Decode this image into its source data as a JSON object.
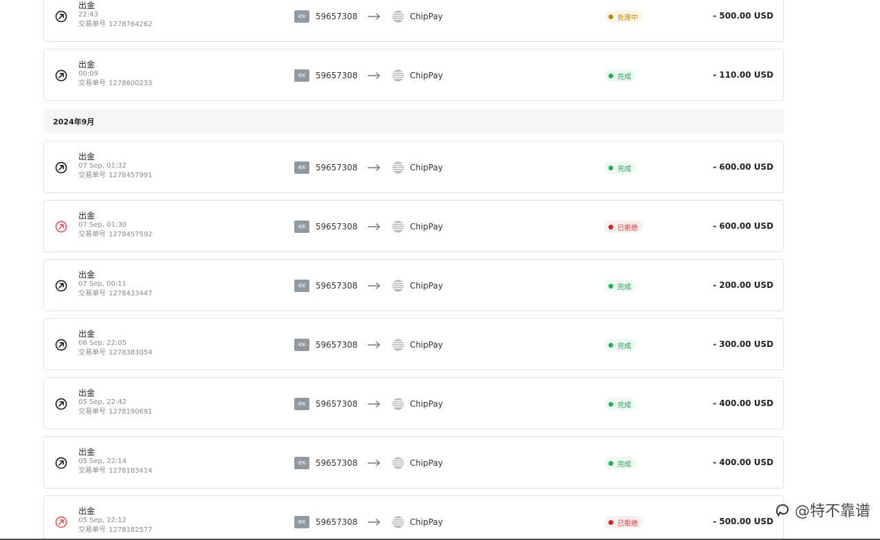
{
  "transactions_top": [
    {
      "type": "出金",
      "time": "22:43",
      "ref_label": "交易单号",
      "ref": "1278764262",
      "account": "59657308",
      "dest": "ChipPay",
      "status": "处理中",
      "status_kind": "processing",
      "amount": "- 500.00 USD",
      "icon_state": "normal"
    },
    {
      "type": "出金",
      "time": "00:09",
      "ref_label": "交易单号",
      "ref": "1278600233",
      "account": "59657308",
      "dest": "ChipPay",
      "status": "完成",
      "status_kind": "done",
      "amount": "- 110.00 USD",
      "icon_state": "normal"
    }
  ],
  "group": {
    "label": "2024年9月"
  },
  "transactions": [
    {
      "type": "出金",
      "time": "07 Sep, 01:32",
      "ref_label": "交易单号",
      "ref": "1278457991",
      "account": "59657308",
      "dest": "ChipPay",
      "status": "完成",
      "status_kind": "done",
      "amount": "- 600.00 USD",
      "icon_state": "normal"
    },
    {
      "type": "出金",
      "time": "07 Sep, 01:30",
      "ref_label": "交易单号",
      "ref": "1278457592",
      "account": "59657308",
      "dest": "ChipPay",
      "status": "已拒绝",
      "status_kind": "rejected",
      "amount": "- 600.00 USD",
      "icon_state": "rejected"
    },
    {
      "type": "出金",
      "time": "07 Sep, 00:11",
      "ref_label": "交易单号",
      "ref": "1278433447",
      "account": "59657308",
      "dest": "ChipPay",
      "status": "完成",
      "status_kind": "done",
      "amount": "- 200.00 USD",
      "icon_state": "normal"
    },
    {
      "type": "出金",
      "time": "06 Sep, 22:05",
      "ref_label": "交易单号",
      "ref": "1278383054",
      "account": "59657308",
      "dest": "ChipPay",
      "status": "完成",
      "status_kind": "done",
      "amount": "- 300.00 USD",
      "icon_state": "normal"
    },
    {
      "type": "出金",
      "time": "05 Sep, 22:42",
      "ref_label": "交易单号",
      "ref": "1278190691",
      "account": "59657308",
      "dest": "ChipPay",
      "status": "完成",
      "status_kind": "done",
      "amount": "- 400.00 USD",
      "icon_state": "normal"
    },
    {
      "type": "出金",
      "time": "05 Sep, 22:14",
      "ref_label": "交易单号",
      "ref": "1278183414",
      "account": "59657308",
      "dest": "ChipPay",
      "status": "完成",
      "status_kind": "done",
      "amount": "- 400.00 USD",
      "icon_state": "normal"
    },
    {
      "type": "出金",
      "time": "05 Sep, 22:12",
      "ref_label": "交易单号",
      "ref": "1278182577",
      "account": "59657308",
      "dest": "ChipPay",
      "status": "已拒绝",
      "status_kind": "rejected",
      "amount": "- 500.00 USD",
      "icon_state": "rejected"
    }
  ],
  "source_badge": "ex",
  "colors": {
    "done": "#22b05a",
    "processing": "#b98a1c",
    "rejected": "#c62828",
    "icon_normal": "#222222",
    "icon_rejected": "#e05a5a"
  },
  "icons": {
    "direction": "arrow-up-right-circle-icon",
    "route_arrow": "arrow-right-icon",
    "destination": "chippay-logo-icon"
  },
  "watermark": {
    "text": "@特不靠谱"
  }
}
